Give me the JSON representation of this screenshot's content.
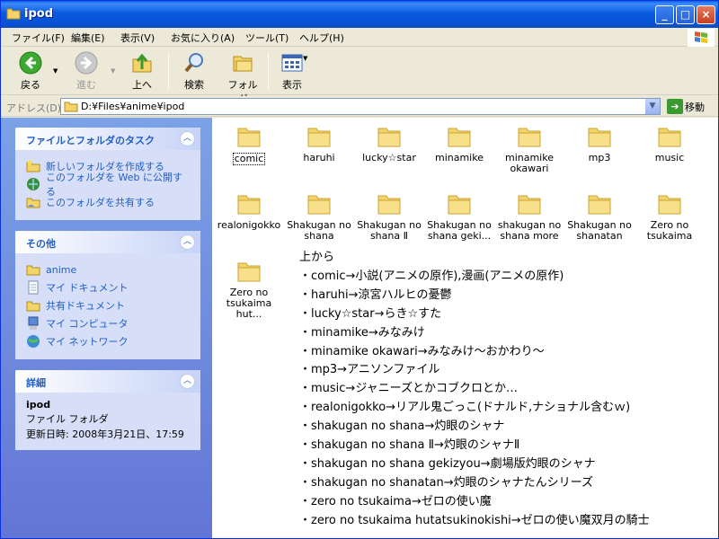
{
  "window": {
    "title": "ipod"
  },
  "title_buttons": [
    "_",
    "□",
    "×"
  ],
  "menu": [
    "ファイル(F)",
    "編集(E)",
    "表示(V)",
    "お気に入り(A)",
    "ツール(T)",
    "ヘルプ(H)"
  ],
  "toolbar": {
    "back": "戻る",
    "forward": "進む",
    "up": "上へ",
    "search": "検索",
    "folders": "フォルダ",
    "views": "表示"
  },
  "address": {
    "label": "アドレス(D)",
    "path": "D:¥Files¥anime¥ipod",
    "go": "移動"
  },
  "tasks_panel": {
    "title": "ファイルとフォルダのタスク",
    "items": [
      "新しいフォルダを作成する",
      "このフォルダを Web に公開する",
      "このフォルダを共有する"
    ]
  },
  "other_panel": {
    "title": "その他",
    "items": [
      "anime",
      "マイ ドキュメント",
      "共有ドキュメント",
      "マイ コンピュータ",
      "マイ ネットワーク"
    ]
  },
  "details_panel": {
    "title": "詳細",
    "name": "ipod",
    "type": "ファイル フォルダ",
    "modified": "更新日時: 2008年3月21日、17:59"
  },
  "folders": [
    {
      "line1": "comic",
      "line2": ""
    },
    {
      "line1": "haruhi",
      "line2": ""
    },
    {
      "line1": "lucky☆star",
      "line2": ""
    },
    {
      "line1": "minamike",
      "line2": ""
    },
    {
      "line1": "minamike",
      "line2": "okawari"
    },
    {
      "line1": "mp3",
      "line2": ""
    },
    {
      "line1": "music",
      "line2": ""
    },
    {
      "line1": "realonigokko",
      "line2": ""
    },
    {
      "line1": "Shakugan no",
      "line2": "shana"
    },
    {
      "line1": "Shakugan no",
      "line2": "shana Ⅱ"
    },
    {
      "line1": "Shakugan no",
      "line2": "shana geki..."
    },
    {
      "line1": "shakugan no",
      "line2": "shana more"
    },
    {
      "line1": "Shakugan no",
      "line2": "shanatan"
    },
    {
      "line1": "Zero no",
      "line2": "tsukaima"
    },
    {
      "line1": "Zero no",
      "line2": "tsukaima hut..."
    }
  ],
  "notes": [
    "上から",
    "・comic→小説(アニメの原作),漫画(アニメの原作)",
    "・haruhi→涼宮ハルヒの憂鬱",
    "・lucky☆star→らき☆すた",
    "・minamike→みなみけ",
    "・minamike okawari→みなみけ～おかわり～",
    "・mp3→アニソンファイル",
    "・music→ジャニーズとかコブクロとか…",
    "・realonigokko→リアル鬼ごっこ(ドナルド,ナショナル含むｗ)",
    "・shakugan no shana→灼眼のシャナ",
    "・shakugan no shana Ⅱ→灼眼のシャナⅡ",
    "・shakugan no shana gekizyou→劇場版灼眼のシャナ",
    "・shakugan no shanatan→灼眼のシャナたんシリーズ",
    "・zero no tsukaima→ゼロの使い魔",
    "・zero no tsukaima hutatsukinokishi→ゼロの使い魔双月の騎士"
  ]
}
